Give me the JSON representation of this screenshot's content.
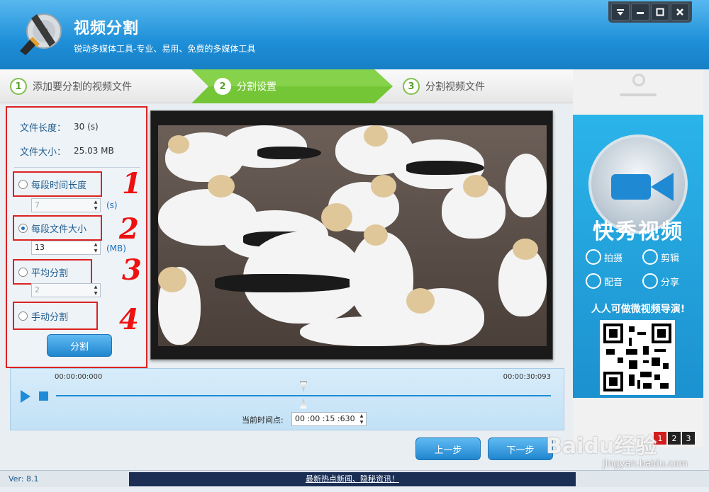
{
  "app": {
    "title": "视频分割",
    "subtitle": "锐动多媒体工具-专业、易用、免费的多媒体工具"
  },
  "window_controls": [
    "menu-icon",
    "minimize-icon",
    "maximize-icon",
    "close-icon"
  ],
  "steps": [
    {
      "num": "1",
      "label": "添加要分割的视频文件"
    },
    {
      "num": "2",
      "label": "分割设置"
    },
    {
      "num": "3",
      "label": "分割视频文件"
    }
  ],
  "file_info": {
    "length_label": "文件长度：",
    "length_value": "30 (s)",
    "size_label": "文件大小：",
    "size_value": "25.03 MB"
  },
  "options": {
    "by_time": {
      "label": "每段时间长度",
      "value": "7",
      "unit": "(s)",
      "selected": false
    },
    "by_size": {
      "label": "每段文件大小",
      "value": "13",
      "unit": "(MB)",
      "selected": true
    },
    "even": {
      "label": "平均分割",
      "value": "2",
      "selected": false
    },
    "manual": {
      "label": "手动分割",
      "selected": false
    }
  },
  "split_button": "分割",
  "annotations": [
    "1",
    "2",
    "3",
    "4"
  ],
  "timeline": {
    "start": "00:00:00:000",
    "end": "00:00:30:093",
    "current_label": "当前时间点:",
    "current_value": "00 :00 :15 :630",
    "marker_fraction": 0.5
  },
  "nav": {
    "prev": "上一步",
    "next": "下一步"
  },
  "status": {
    "version": "Ver: 8.1",
    "news": "最新热点新闻、隐秘资讯！"
  },
  "ad": {
    "brand": "快秀视频",
    "features": [
      "拍摄",
      "剪辑",
      "配音",
      "分享"
    ],
    "slogan": "人人可做微视频导演!",
    "pages": [
      "1",
      "2",
      "3"
    ]
  },
  "watermark": {
    "text": "Baidu经验",
    "url": "jingyan.baidu.com"
  },
  "colors": {
    "title_blue": "#1e8fd8",
    "step_active": "#6cbf2e",
    "highlight_red": "#dd2222",
    "button_blue": "#2186cf"
  }
}
